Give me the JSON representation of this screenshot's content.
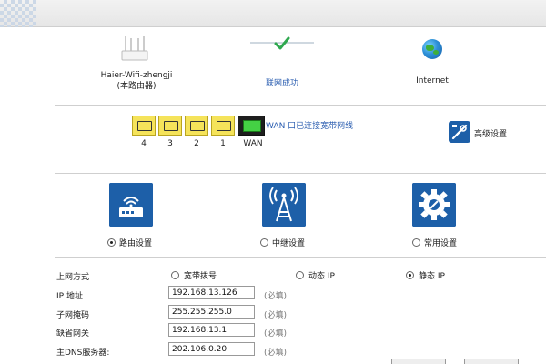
{
  "status": {
    "router_name": "Haier-Wifi-zhengji",
    "router_sub": "(本路由器)",
    "connect_status": "联网成功",
    "internet_label": "Internet"
  },
  "ports": {
    "lan": [
      "4",
      "3",
      "2",
      "1"
    ],
    "wan": "WAN",
    "wan_message": "WAN 口已连接宽带网线",
    "lan_color": "#f5e35a",
    "wan_led_color": "#44d144"
  },
  "advanced": {
    "label": "高级设置"
  },
  "modes": [
    {
      "label": "路由设置",
      "selected": true,
      "icon": "router-icon"
    },
    {
      "label": "中继设置",
      "selected": false,
      "icon": "tower-icon"
    },
    {
      "label": "常用设置",
      "selected": false,
      "icon": "gear-icon"
    }
  ],
  "form": {
    "connection_type_label": "上网方式",
    "connection_options": [
      "宽带拨号",
      "动态 IP",
      "静态 IP"
    ],
    "connection_selected": "静态 IP",
    "fields": [
      {
        "label": "IP 地址",
        "value": "192.168.13.126",
        "note": "(必填)"
      },
      {
        "label": "子网掩码",
        "value": "255.255.255.0",
        "note": "(必填)"
      },
      {
        "label": "缺省网关",
        "value": "192.168.13.1",
        "note": "(必填)"
      },
      {
        "label": "主DNS服务器:",
        "value": "202.106.0.20",
        "note": "(必填)"
      }
    ]
  },
  "colors": {
    "accent_blue": "#1d5fa8",
    "link_blue": "#2a5db0"
  }
}
